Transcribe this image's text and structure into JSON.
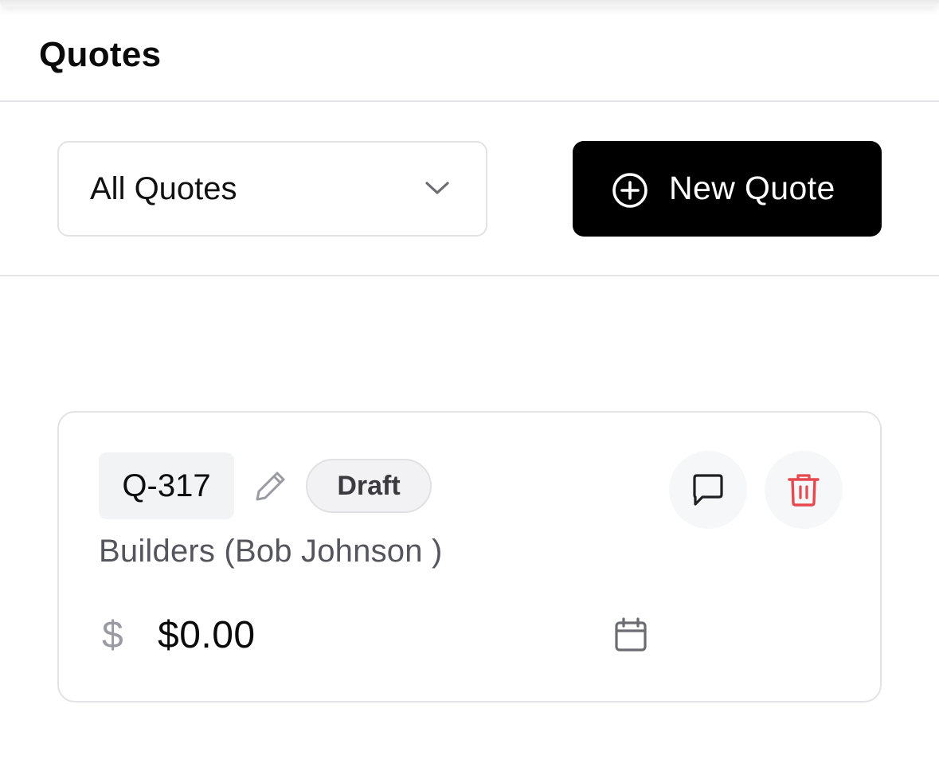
{
  "header": {
    "title": "Quotes"
  },
  "toolbar": {
    "filter": {
      "value": "All Quotes",
      "icon": "chevron-down-icon"
    },
    "new_quote": {
      "label": "New Quote",
      "icon": "plus-circle-icon"
    }
  },
  "quotes": [
    {
      "id": "Q-317",
      "status": "Draft",
      "customer": "Builders (Bob Johnson )",
      "amount": "$0.00",
      "currency_symbol": "$",
      "icons": [
        "pencil-icon",
        "comment-icon",
        "trash-icon",
        "calendar-icon"
      ]
    }
  ],
  "colors": {
    "primary": "#000000",
    "danger": "#e5484d",
    "muted": "#9a9aa2",
    "border": "#e3e3e6"
  }
}
